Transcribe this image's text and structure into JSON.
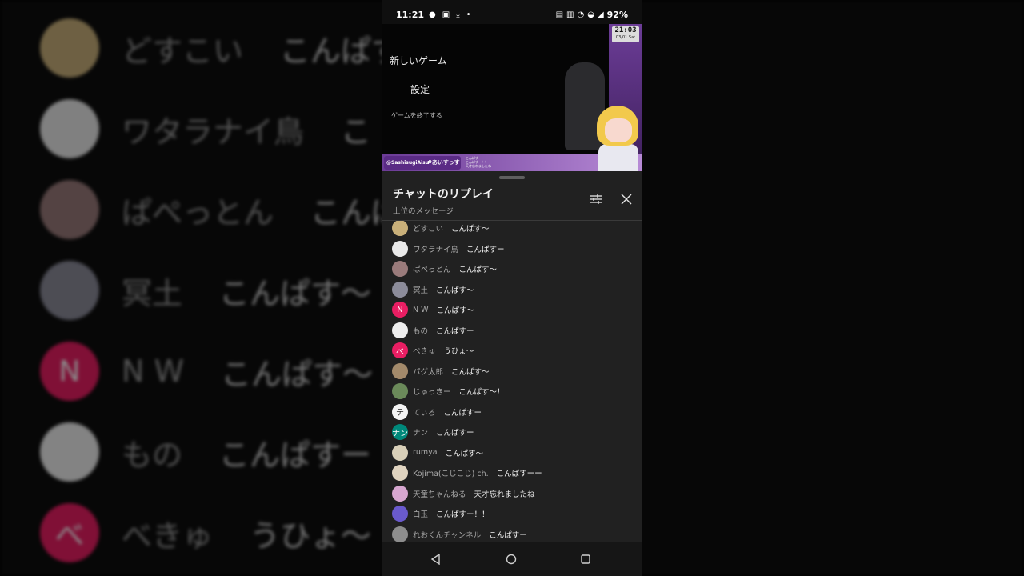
{
  "status_bar": {
    "time": "11:21",
    "battery": "92%",
    "left_icons": [
      "chat-bubble-icon",
      "image-icon",
      "download-icon",
      "dot-icon"
    ],
    "right_icons": [
      "nfc-icon",
      "cast-icon",
      "mute-icon",
      "wifi-icon",
      "signal-icon"
    ]
  },
  "video": {
    "menu_new_game": "新しいゲーム",
    "menu_settings": "設定",
    "menu_quit": "ゲームを終了する",
    "clock_time": "21:03",
    "clock_date": "03/01 Sat",
    "handle": "@SashisugiAisu",
    "hashtag": "#あいすっす",
    "mini_chat": [
      "こんぱすー",
      "こんぱすー！！",
      "天才忘れましたね"
    ]
  },
  "sheet": {
    "title": "チャットのリプレイ",
    "subtitle": "上位のメッセージ"
  },
  "messages": [
    {
      "name": "どすこい",
      "text": "こんぱす〜",
      "avatar_color": "#c9b07a",
      "avatar_char": ""
    },
    {
      "name": "ワタラナイ鳥",
      "text": "こんぱすー",
      "avatar_color": "#e9e9e9",
      "avatar_char": ""
    },
    {
      "name": "ぱぺっとん",
      "text": "こんぱす〜",
      "avatar_color": "#9a7b7b",
      "avatar_char": ""
    },
    {
      "name": "冥土",
      "text": "こんぱす〜",
      "avatar_color": "#8c8c9a",
      "avatar_char": ""
    },
    {
      "name": "N W",
      "text": "こんぱす〜",
      "avatar_color": "#e91e63",
      "avatar_char": "N"
    },
    {
      "name": "もの",
      "text": "こんぱすー",
      "avatar_color": "#eeeeee",
      "avatar_char": ""
    },
    {
      "name": "べきゅ",
      "text": "うひょ〜",
      "avatar_color": "#e91e63",
      "avatar_char": "べ"
    },
    {
      "name": "パグ太郎",
      "text": "こんぱす〜",
      "avatar_color": "#a38a6b",
      "avatar_char": ""
    },
    {
      "name": "じゅっきー",
      "text": "こんぱす〜！",
      "avatar_color": "#6b8a5a",
      "avatar_char": ""
    },
    {
      "name": "てぃろ",
      "text": "こんぱすー",
      "avatar_color": "#f4f4f4",
      "avatar_char": "テ"
    },
    {
      "name": "ナン",
      "text": "こんぱすー",
      "avatar_color": "#00897b",
      "avatar_char": "ナン"
    },
    {
      "name": "rumya",
      "text": "こんぱす〜",
      "avatar_color": "#d8cfb8",
      "avatar_char": ""
    },
    {
      "name": "Kojima(こじこじ) ch.",
      "text": "こんぱすーー",
      "avatar_color": "#e0d4c0",
      "avatar_char": ""
    },
    {
      "name": "天童ちゃんねる",
      "text": "天才忘れましたね",
      "avatar_color": "#d7a7d0",
      "avatar_char": ""
    },
    {
      "name": "白玉",
      "text": "こんぱすー！！",
      "avatar_color": "#6a5acd",
      "avatar_char": ""
    },
    {
      "name": "れおくんチャンネル",
      "text": "こんぱすー",
      "avatar_color": "#8d8d8d",
      "avatar_char": ""
    }
  ],
  "background_zoom": [
    {
      "name": "どすこい",
      "text": "こんぱす",
      "avatar_color": "#c9b07a",
      "avatar_char": ""
    },
    {
      "name": "ワタラナイ鳥",
      "text": "こ",
      "avatar_color": "#e9e9e9",
      "avatar_char": ""
    },
    {
      "name": "ぱぺっとん",
      "text": "こんぱ",
      "avatar_color": "#9a7b7b",
      "avatar_char": ""
    },
    {
      "name": "冥土",
      "text": "こんぱす〜",
      "avatar_color": "#8c8c9a",
      "avatar_char": ""
    },
    {
      "name": "N W",
      "text": "こんぱす〜",
      "avatar_color": "#e91e63",
      "avatar_char": "N"
    },
    {
      "name": "もの",
      "text": "こんぱすー",
      "avatar_color": "#eeeeee",
      "avatar_char": ""
    },
    {
      "name": "べきゅ",
      "text": "うひょ〜",
      "avatar_color": "#e91e63",
      "avatar_char": "べ"
    }
  ],
  "nav": {
    "icons": [
      "back-icon",
      "home-icon",
      "recents-icon"
    ]
  }
}
